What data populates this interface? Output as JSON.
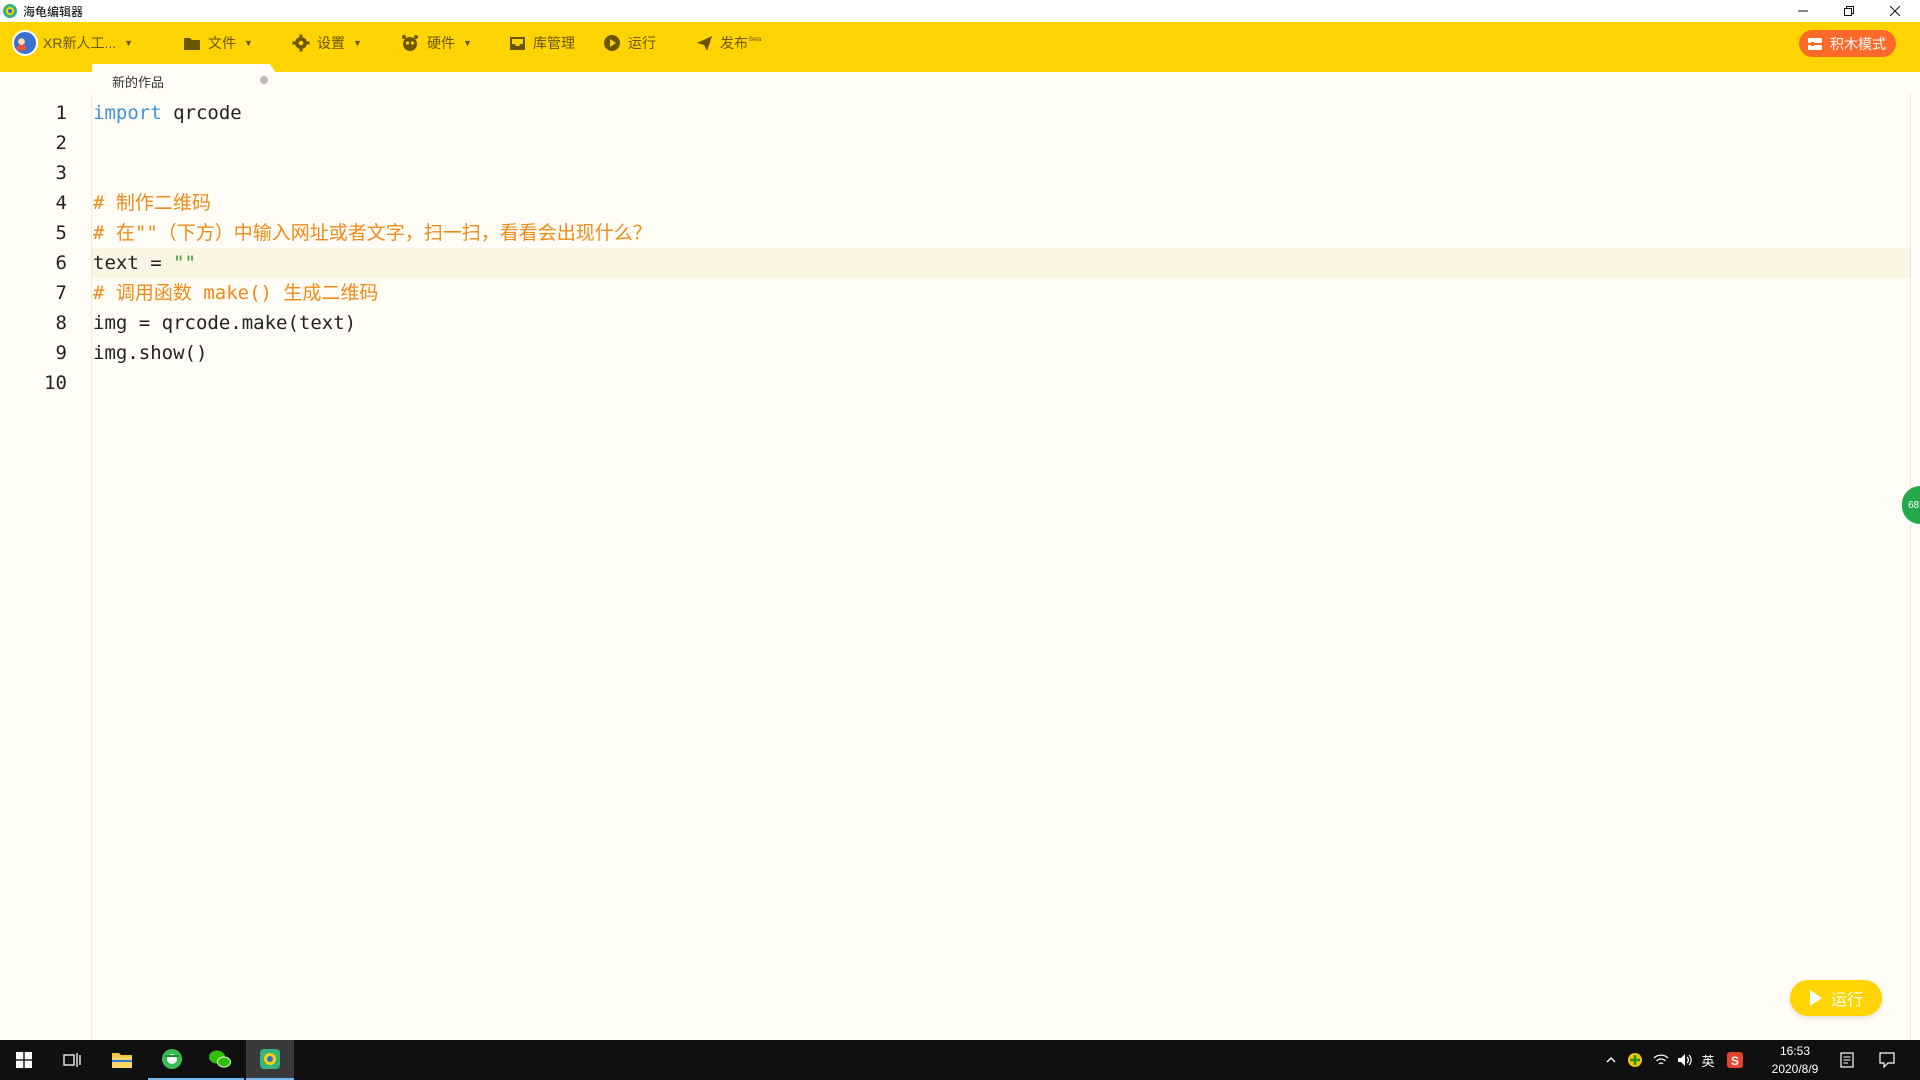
{
  "window": {
    "title": "海龟编辑器"
  },
  "toolbar": {
    "user": "XR新人工...",
    "file": "文件",
    "settings": "设置",
    "hardware": "硬件",
    "library": "库管理",
    "run": "运行",
    "publish": "发布",
    "publish_badge": "Beta",
    "blocks_mode": "积木模式"
  },
  "tabs": [
    {
      "label": "新的作品",
      "modified": true
    }
  ],
  "editor": {
    "current_line": 6,
    "lines": [
      [
        {
          "t": "import",
          "c": "kw"
        },
        {
          "t": " qrcode",
          "c": ""
        }
      ],
      [],
      [],
      [
        {
          "t": "# 制作二维码",
          "c": "cm"
        }
      ],
      [
        {
          "t": "# 在\"\"（下方）中输入网址或者文字，扫一扫，看看会出现什么？",
          "c": "cm"
        }
      ],
      [
        {
          "t": "text = ",
          "c": ""
        },
        {
          "t": "\"\"",
          "c": "str"
        }
      ],
      [
        {
          "t": "# 调用函数 make() 生成二维码",
          "c": "cm"
        }
      ],
      [
        {
          "t": "img = qrcode.make(text)",
          "c": ""
        }
      ],
      [
        {
          "t": "img.show()",
          "c": ""
        }
      ],
      []
    ]
  },
  "side_badge": "68",
  "run_button": "运行",
  "taskbar": {
    "ime": "英",
    "time": "16:53",
    "date": "2020/8/9"
  }
}
